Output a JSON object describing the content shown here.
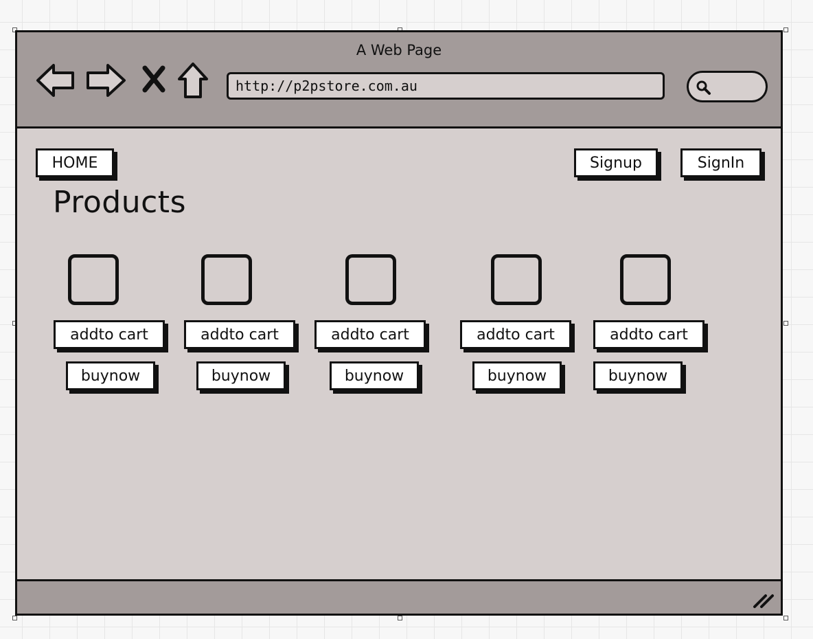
{
  "window": {
    "title": "A Web Page"
  },
  "toolbar": {
    "url": "http://p2pstore.com.au",
    "icons": [
      "back-arrow-icon",
      "forward-arrow-icon",
      "stop-icon",
      "home-icon",
      "search-icon"
    ]
  },
  "nav": {
    "home_label": "HOME",
    "signup_label": "Signup",
    "signin_label": "SignIn"
  },
  "main": {
    "title": "Products",
    "products": [
      {
        "add_to_cart_label": "addto cart",
        "buy_now_label": "buynow"
      },
      {
        "add_to_cart_label": "addto cart",
        "buy_now_label": "buynow"
      },
      {
        "add_to_cart_label": "addto cart",
        "buy_now_label": "buynow"
      },
      {
        "add_to_cart_label": "addto cart",
        "buy_now_label": "buynow"
      },
      {
        "add_to_cart_label": "addto cart",
        "buy_now_label": "buynow"
      }
    ]
  },
  "colors": {
    "chrome": "#a39b9a",
    "content": "#d6cfce",
    "stroke": "#111111",
    "button": "#ffffff"
  }
}
